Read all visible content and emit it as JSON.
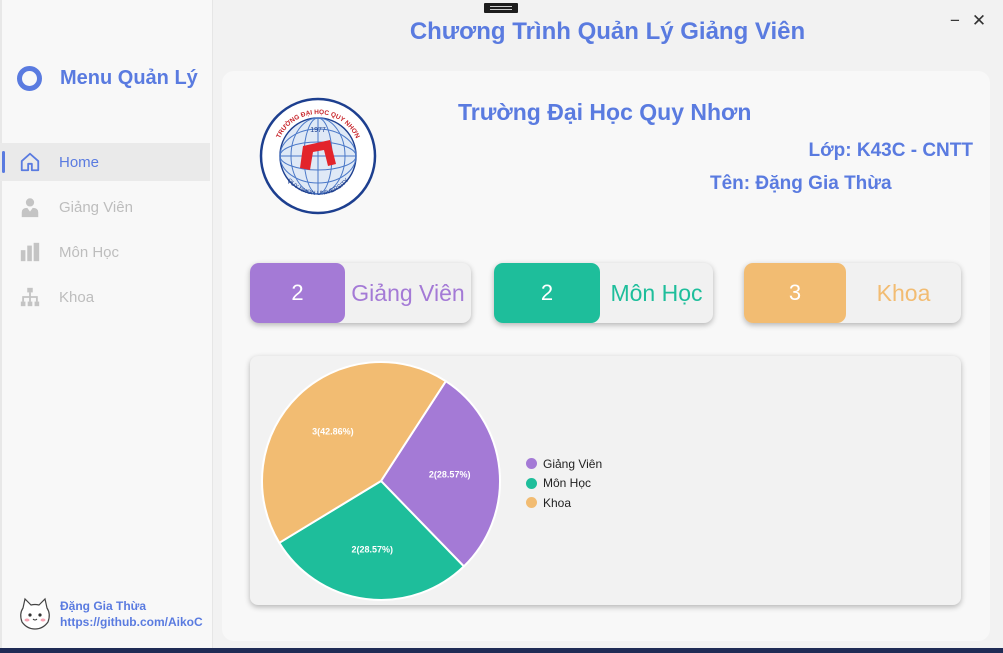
{
  "app": {
    "title": "Chương Trình Quản Lý Giảng Viên"
  },
  "sidebar": {
    "title": "Menu Quản Lý",
    "items": [
      {
        "label": "Home",
        "icon": "home-icon",
        "active": true
      },
      {
        "label": "Giảng Viên",
        "icon": "person-icon",
        "active": false
      },
      {
        "label": "Môn Học",
        "icon": "books-icon",
        "active": false
      },
      {
        "label": "Khoa",
        "icon": "org-chart-icon",
        "active": false
      }
    ],
    "footer": {
      "name": "Đặng Gia Thừa",
      "link": "https://github.com/AikoC"
    }
  },
  "header": {
    "school": "Trường Đại Học Quy Nhơn",
    "class_label": "Lớp: K43C - CNTT",
    "name_label": "Tên: Đặng Gia Thừa"
  },
  "seal": {
    "top": "TRƯỜNG ĐẠI HỌC QUY NHƠN",
    "year": "1977",
    "bottom": "QUY NHON UNIVERSITY"
  },
  "stats": [
    {
      "value": "2",
      "label": "Giảng Viên",
      "color": "#a47ad6"
    },
    {
      "value": "2",
      "label": "Môn Học",
      "color": "#1ebe9b"
    },
    {
      "value": "3",
      "label": "Khoa",
      "color": "#f2bc72"
    }
  ],
  "chart_data": {
    "type": "pie",
    "categories": [
      "Giảng Viên",
      "Môn Học",
      "Khoa"
    ],
    "values": [
      2,
      2,
      3
    ],
    "labels": [
      "2(28.57%)",
      "2(28.57%)",
      "3(42.86%)"
    ],
    "colors": [
      "#a47ad6",
      "#1ebe9b",
      "#f2bc72"
    ],
    "legend_position": "right"
  }
}
